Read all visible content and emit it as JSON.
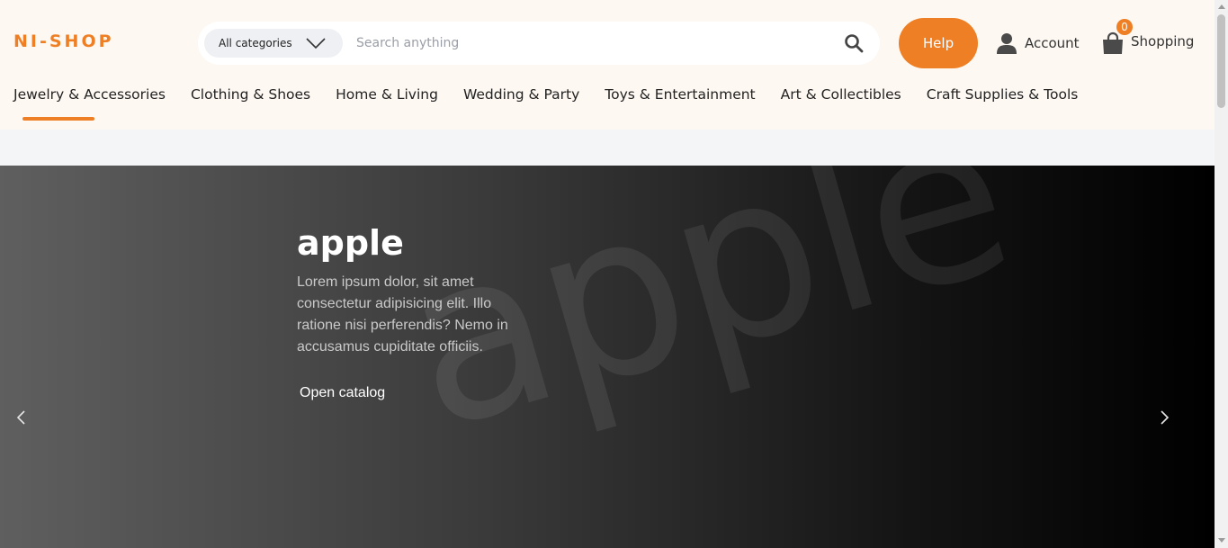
{
  "brand": {
    "logo_text": "NI-SHOP",
    "accent_color": "#ee7f24"
  },
  "search": {
    "category_label": "All categories",
    "placeholder": "Search anything",
    "value": ""
  },
  "header": {
    "help_label": "Help",
    "account_label": "Account",
    "cart_label": "Shopping",
    "cart_count": "0"
  },
  "categories": [
    {
      "label": "Jewelry & Accessories",
      "active": true
    },
    {
      "label": "Clothing & Shoes"
    },
    {
      "label": "Home & Living"
    },
    {
      "label": "Wedding & Party"
    },
    {
      "label": "Toys & Entertainment"
    },
    {
      "label": "Art & Collectibles"
    },
    {
      "label": "Craft Supplies & Tools"
    }
  ],
  "hero": {
    "title": "apple",
    "watermark": "apple",
    "description": "Lorem ipsum dolor, sit amet consectetur adipisicing elit. Illo ratione nisi perferendis? Nemo in accusamus cupiditate officiis.",
    "cta_label": "Open catalog"
  },
  "icons": {
    "chevron": "chevron-down-icon",
    "search": "search-icon",
    "account": "user-icon",
    "cart": "shopping-bag-icon",
    "prev": "chevron-left-icon",
    "next": "chevron-right-icon"
  }
}
